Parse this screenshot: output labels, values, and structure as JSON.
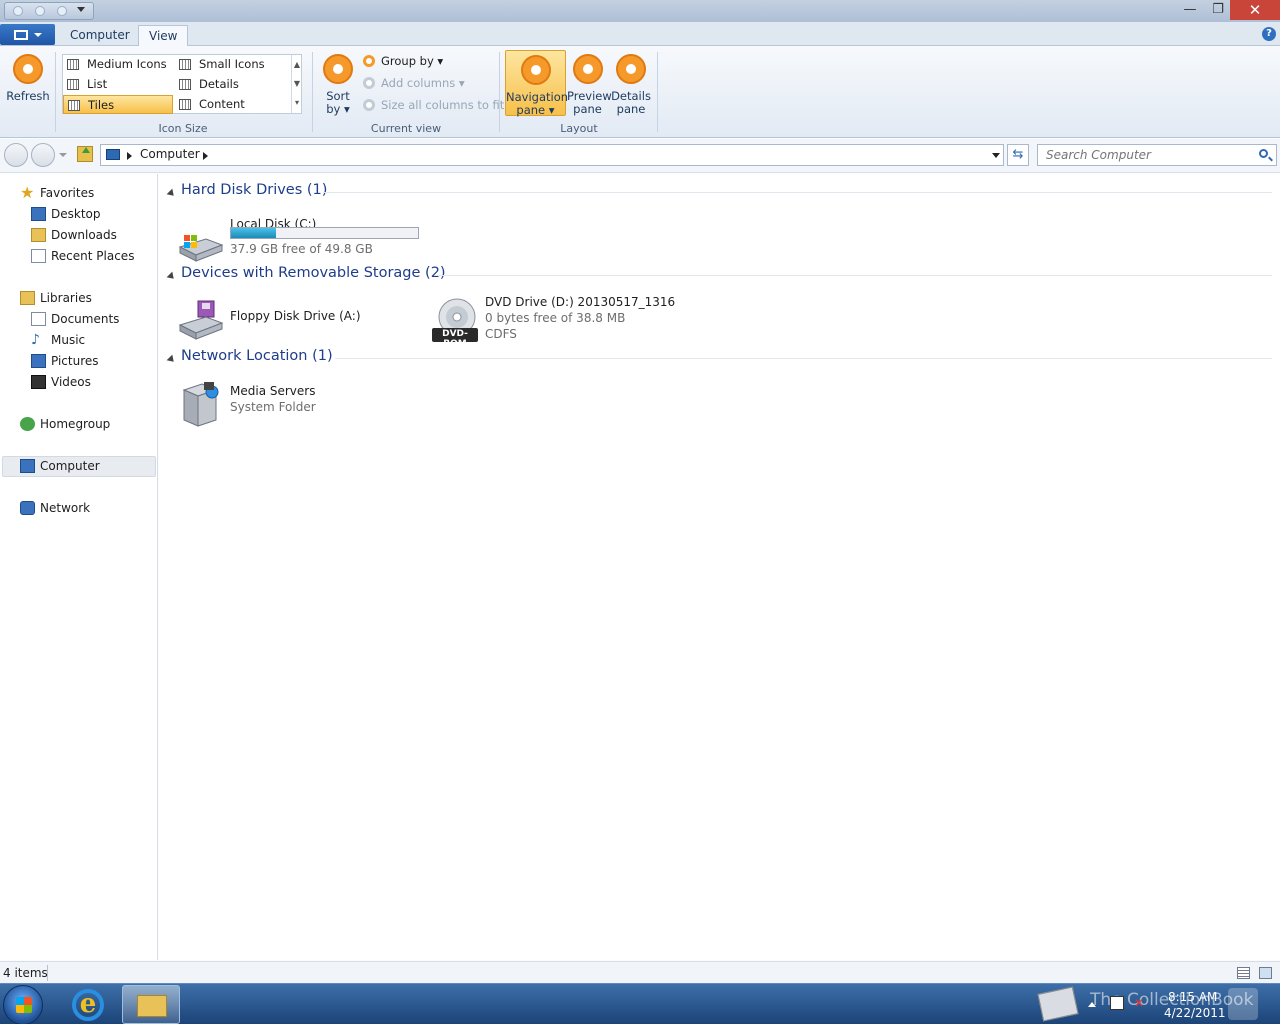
{
  "window": {
    "close_glyph": "✕",
    "minimize_glyph": "—",
    "maximize_glyph": "❐"
  },
  "ribbon": {
    "tabs": [
      {
        "label": "Computer"
      },
      {
        "label": "View"
      }
    ],
    "help_glyph": "?",
    "refresh_label": "Refresh",
    "icon_size": {
      "group_label": "Icon Size",
      "items": [
        {
          "label": "Medium Icons"
        },
        {
          "label": "Small Icons"
        },
        {
          "label": "List"
        },
        {
          "label": "Details"
        },
        {
          "label": "Tiles"
        },
        {
          "label": "Content"
        }
      ]
    },
    "current_view": {
      "group_label": "Current view",
      "sort_by": {
        "line1": "Sort",
        "line2": "by ▾"
      },
      "group_by": "Group by ▾",
      "add_columns": "Add columns ▾",
      "size_columns": "Size all columns to fit"
    },
    "layout": {
      "group_label": "Layout",
      "navigation_pane": {
        "line1": "Navigation",
        "line2": "pane ▾"
      },
      "preview_pane": {
        "line1": "Preview",
        "line2": "pane"
      },
      "details_pane": {
        "line1": "Details",
        "line2": "pane"
      }
    }
  },
  "address": {
    "crumbs": [
      {
        "label": "Computer"
      }
    ],
    "refresh_glyph": "⇆",
    "search_placeholder": "Search Computer"
  },
  "nav": {
    "favorites": {
      "label": "Favorites",
      "items": [
        {
          "label": "Desktop"
        },
        {
          "label": "Downloads"
        },
        {
          "label": "Recent Places"
        }
      ]
    },
    "libraries": {
      "label": "Libraries",
      "items": [
        {
          "label": "Documents"
        },
        {
          "label": "Music"
        },
        {
          "label": "Pictures"
        },
        {
          "label": "Videos"
        }
      ]
    },
    "homegroup": "Homegroup",
    "computer": "Computer",
    "network": "Network"
  },
  "content": {
    "groups": [
      {
        "title": "Hard Disk Drives (1)",
        "items": [
          {
            "name": "Local Disk (C:)",
            "detail": "37.9 GB free of 49.8 GB",
            "used_fraction": 0.24
          }
        ]
      },
      {
        "title": "Devices with Removable Storage (2)",
        "items": [
          {
            "name": "Floppy Disk Drive (A:)"
          },
          {
            "name": "DVD Drive (D:) 20130517_1316",
            "detail": "0 bytes free of 38.8 MB",
            "detail2": "CDFS",
            "icon_label": "DVD-ROM"
          }
        ]
      },
      {
        "title": "Network Location (1)",
        "items": [
          {
            "name": "Media Servers",
            "detail": "System Folder"
          }
        ]
      }
    ]
  },
  "status": {
    "item_count": "4 items"
  },
  "taskbar": {
    "clock_time": "8:15 AM",
    "clock_date": "4/22/2011",
    "watermark": "The CollectionBook",
    "ie_glyph": "e"
  },
  "colors": {
    "accent": "#f59a2a",
    "link_blue": "#1e3d8a",
    "capacity_fill": "#1d8ab8"
  }
}
